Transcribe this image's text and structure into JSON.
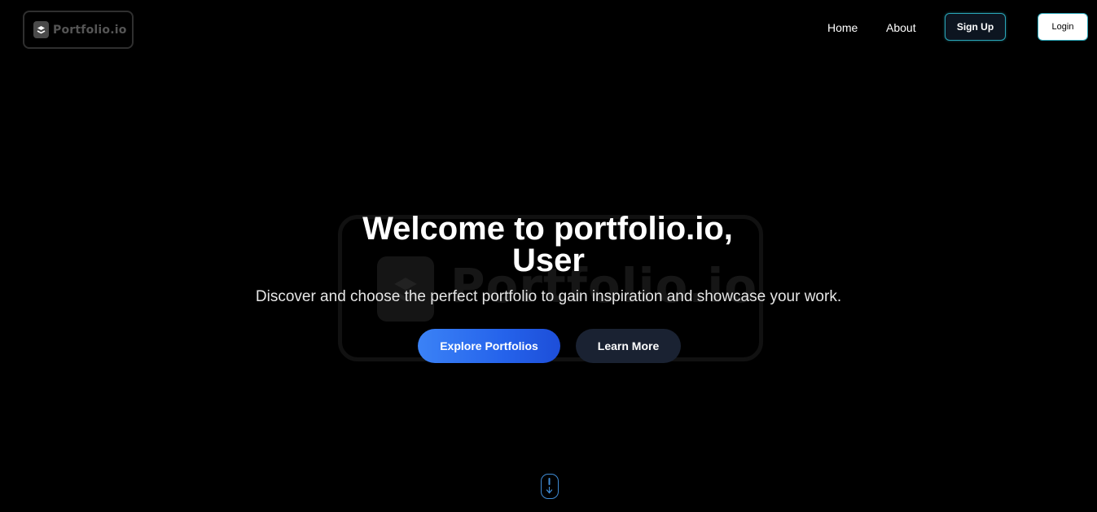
{
  "header": {
    "logo_text": "Portfolio.io",
    "nav": {
      "home": "Home",
      "about": "About"
    },
    "signup_label": "Sign Up",
    "login_label": "Login"
  },
  "hero": {
    "title_line1": "Welcome to portfolio.io,",
    "title_line2": "User",
    "subtitle": "Discover and choose the perfect portfolio to gain inspiration and showcase your work.",
    "explore_label": "Explore Portfolios",
    "learn_label": "Learn More",
    "watermark_text": "Portfolio.io"
  },
  "scroll_indicator": {
    "icon": "mouse-scroll-icon"
  },
  "colors": {
    "background": "#000000",
    "accent_blue": "#2563eb",
    "signup_border": "#2aa6b8",
    "learn_more_bg": "#1a2232"
  }
}
